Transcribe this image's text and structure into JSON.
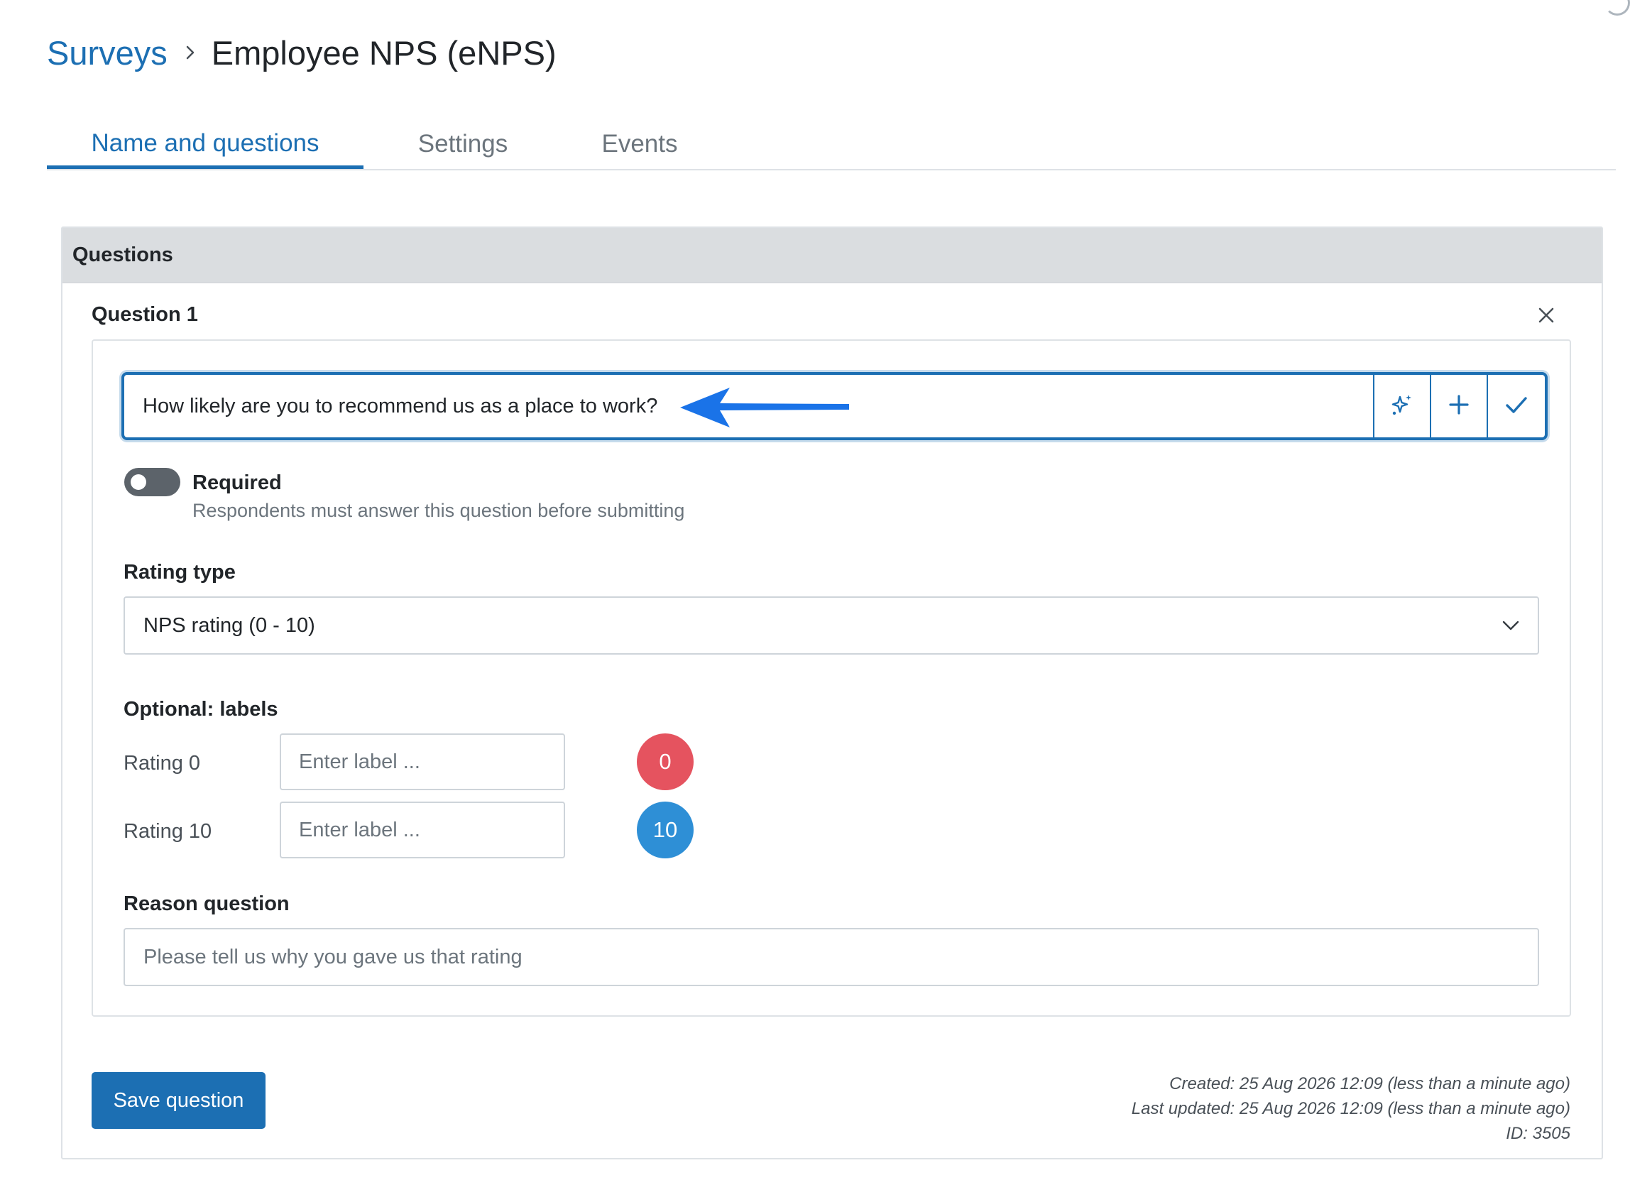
{
  "breadcrumb": {
    "parent": "Surveys",
    "current": "Employee NPS (eNPS)"
  },
  "tabs": [
    {
      "label": "Name and questions",
      "active": true
    },
    {
      "label": "Settings",
      "active": false
    },
    {
      "label": "Events",
      "active": false
    }
  ],
  "questions_card": {
    "header": "Questions",
    "question": {
      "title": "Question 1",
      "text": "How likely are you to recommend us as a place to work?",
      "actions": [
        "sparkle-icon",
        "plus-icon",
        "check-icon"
      ],
      "required": {
        "label": "Required",
        "help": "Respondents must answer this question before submitting",
        "enabled": false
      },
      "rating_type": {
        "label": "Rating type",
        "selected": "NPS rating (0 - 10)"
      },
      "labels": {
        "heading": "Optional: labels",
        "rows": [
          {
            "name": "Rating 0",
            "placeholder": "Enter label ...",
            "badge": "0",
            "badge_color": "#e5535f"
          },
          {
            "name": "Rating 10",
            "placeholder": "Enter label ...",
            "badge": "10",
            "badge_color": "#2e8fd6"
          }
        ]
      },
      "reason": {
        "label": "Reason question",
        "placeholder": "Please tell us why you gave us that rating"
      }
    }
  },
  "footer": {
    "save_label": "Save question",
    "created": "Created: 25 Aug 2026 12:09 (less than a minute ago)",
    "updated": "Last updated: 25 Aug 2026 12:09 (less than a minute ago)",
    "id": "ID: 3505"
  },
  "colors": {
    "accent": "#1c6fb3",
    "annotation_arrow": "#1a73e8"
  }
}
